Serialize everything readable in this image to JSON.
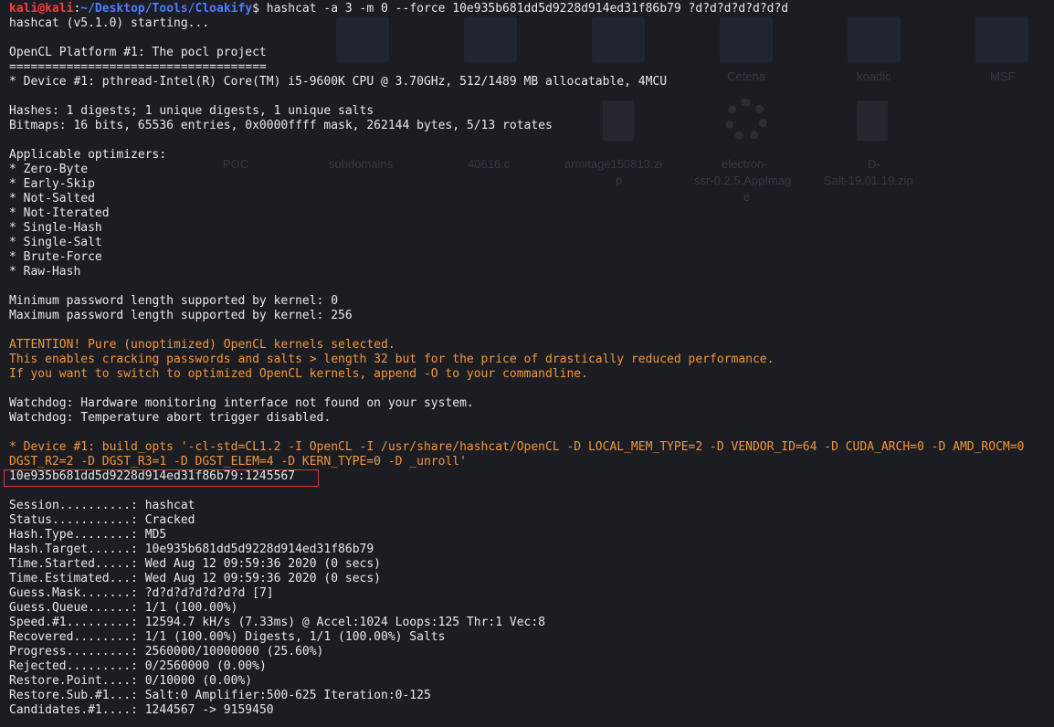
{
  "prompt": {
    "user_host": "kali@kali",
    "separator": ":",
    "path": "~/Desktop/Tools/Cloakify",
    "dollar": "$",
    "command": " hashcat -a 3 -m 0 --force 10e935b681dd5d9228d914ed31f86b79 ?d?d?d?d?d?d?d"
  },
  "lines": {
    "start": "hashcat (v5.1.0) starting...",
    "platform": "OpenCL Platform #1: The pocl project",
    "rule": "====================================",
    "device": "* Device #1: pthread-Intel(R) Core(TM) i5-9600K CPU @ 3.70GHz, 512/1489 MB allocatable, 4MCU",
    "hashes": "Hashes: 1 digests; 1 unique digests, 1 unique salts",
    "bitmaps": "Bitmaps: 16 bits, 65536 entries, 0x0000ffff mask, 262144 bytes, 5/13 rotates",
    "optimizers_header": "Applicable optimizers:",
    "optimizers": [
      "* Zero-Byte",
      "* Early-Skip",
      "* Not-Salted",
      "* Not-Iterated",
      "* Single-Hash",
      "* Single-Salt",
      "* Brute-Force",
      "* Raw-Hash"
    ],
    "min_len": "Minimum password length supported by kernel: 0",
    "max_len": "Maximum password length supported by kernel: 256",
    "attention_1": "ATTENTION! Pure (unoptimized) OpenCL kernels selected.",
    "attention_2": "This enables cracking passwords and salts > length 32 but for the price of drastically reduced performance.",
    "attention_3": "If you want to switch to optimized OpenCL kernels, append -O to your commandline.",
    "watchdog_1": "Watchdog: Hardware monitoring interface not found on your system.",
    "watchdog_2": "Watchdog: Temperature abort trigger disabled.",
    "build_opts_1": "* Device #1: build_opts '-cl-std=CL1.2 -I OpenCL -I /usr/share/hashcat/OpenCL -D LOCAL_MEM_TYPE=2 -D VENDOR_ID=64 -D CUDA_ARCH=0 -D AMD_ROCM=0",
    "build_opts_2": "DGST_R2=2 -D DGST_R3=1 -D DGST_ELEM=4 -D KERN_TYPE=0 -D _unroll'",
    "cracked": "10e935b681dd5d9228d914ed31f86b79:1245567"
  },
  "status": [
    {
      "key": "Session..........: ",
      "value": "hashcat"
    },
    {
      "key": "Status...........: ",
      "value": "Cracked"
    },
    {
      "key": "Hash.Type........: ",
      "value": "MD5"
    },
    {
      "key": "Hash.Target......: ",
      "value": "10e935b681dd5d9228d914ed31f86b79"
    },
    {
      "key": "Time.Started.....: ",
      "value": "Wed Aug 12 09:59:36 2020 (0 secs)"
    },
    {
      "key": "Time.Estimated...: ",
      "value": "Wed Aug 12 09:59:36 2020 (0 secs)"
    },
    {
      "key": "Guess.Mask.......: ",
      "value": "?d?d?d?d?d?d?d [7]"
    },
    {
      "key": "Guess.Queue......: ",
      "value": "1/1 (100.00%)"
    },
    {
      "key": "Speed.#1.........: ",
      "value": "12594.7 kH/s (7.33ms) @ Accel:1024 Loops:125 Thr:1 Vec:8"
    },
    {
      "key": "Recovered........: ",
      "value": "1/1 (100.00%) Digests, 1/1 (100.00%) Salts"
    },
    {
      "key": "Progress.........: ",
      "value": "2560000/10000000 (25.60%)"
    },
    {
      "key": "Rejected.........: ",
      "value": "0/2560000 (0.00%)"
    },
    {
      "key": "Restore.Point....: ",
      "value": "0/10000 (0.00%)"
    },
    {
      "key": "Restore.Sub.#1...: ",
      "value": "Salt:0 Amplifier:500-625 Iteration:0-125"
    },
    {
      "key": "Candidates.#1....: ",
      "value": "1244567 -> 9159450"
    }
  ],
  "background_labels": {
    "poc": "POC",
    "subdomains": "subdomains",
    "c_file": "40616.c",
    "armitage": "armitage150813.zi",
    "armitage_2": "p",
    "electron": "electron-",
    "electron_2": "ssr-0.2.5.AppImag",
    "electron_3": "e",
    "d_salt": "D-",
    "d_salt_2": "Salt-19.01.19.zip",
    "cetena": "Cetena",
    "koadic": "koadic",
    "msf": "MSF"
  },
  "colors": {
    "background": "#1c1d23",
    "text": "#e8e8e8",
    "prompt_user": "#ff3b3b",
    "prompt_path": "#4f7cff",
    "warning": "#f0963c",
    "highlight_border": "#d0393b"
  }
}
